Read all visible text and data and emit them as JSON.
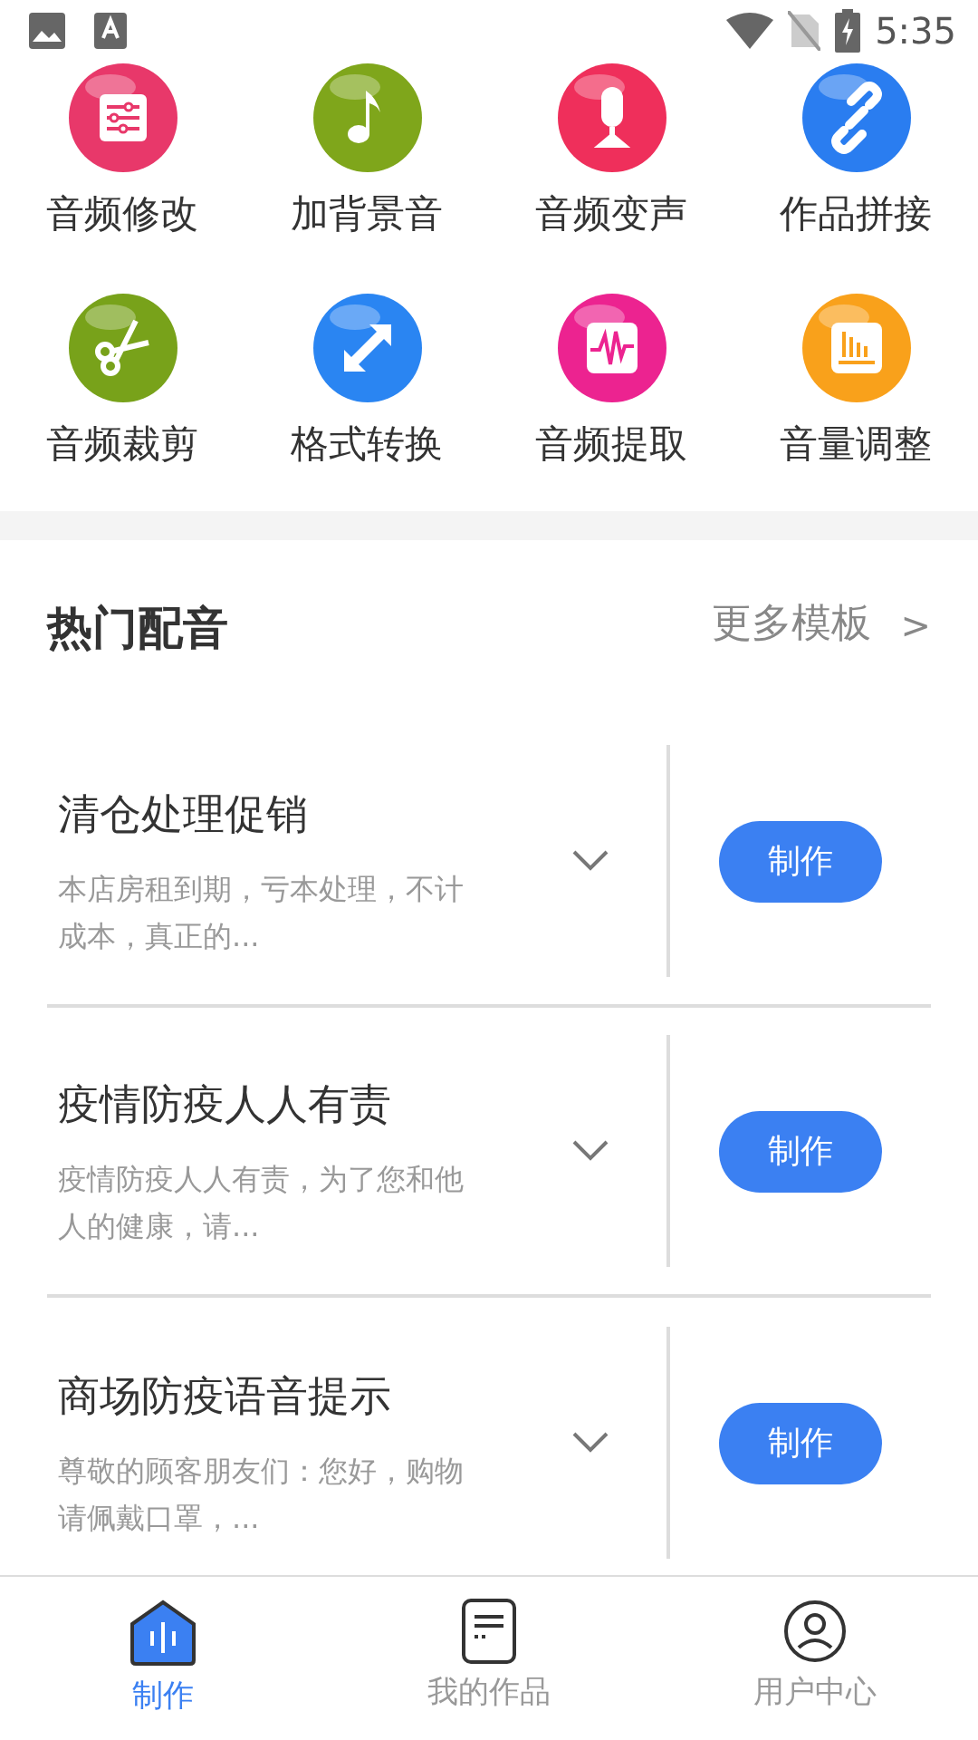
{
  "status_bar": {
    "time": "5:35"
  },
  "tools": [
    {
      "label": "音频修改",
      "kind": "sliders",
      "color": "#e8386a"
    },
    {
      "label": "加背景音",
      "kind": "note",
      "color": "#7fa61b"
    },
    {
      "label": "音频变声",
      "kind": "mic",
      "color": "#ef2f5b"
    },
    {
      "label": "作品拼接",
      "kind": "link",
      "color": "#2a7df0"
    },
    {
      "label": "音频裁剪",
      "kind": "scissors",
      "color": "#78a21a"
    },
    {
      "label": "格式转换",
      "kind": "convert",
      "color": "#2a85f2"
    },
    {
      "label": "音频提取",
      "kind": "wave",
      "color": "#ec2390"
    },
    {
      "label": "音量调整",
      "kind": "bars",
      "color": "#f9a11b"
    }
  ],
  "section": {
    "title": "热门配音",
    "more": "更多模板",
    "more_arrow": ">"
  },
  "templates": [
    {
      "title": "清仓处理促销",
      "summary": "本店房租到期，亏本处理，不计成本，真正的...",
      "button": "制作"
    },
    {
      "title": "疫情防疫人人有责",
      "summary": "疫情防疫人人有责，为了您和他人的健康，请...",
      "button": "制作"
    },
    {
      "title": "商场防疫语音提示",
      "summary": "尊敬的顾客朋友们：您好，购物请佩戴口罩，...",
      "button": "制作"
    }
  ],
  "bottom_nav": [
    {
      "label": "制作",
      "kind": "make",
      "selected": true
    },
    {
      "label": "我的作品",
      "kind": "works",
      "selected": false
    },
    {
      "label": "用户中心",
      "kind": "user",
      "selected": false
    }
  ]
}
